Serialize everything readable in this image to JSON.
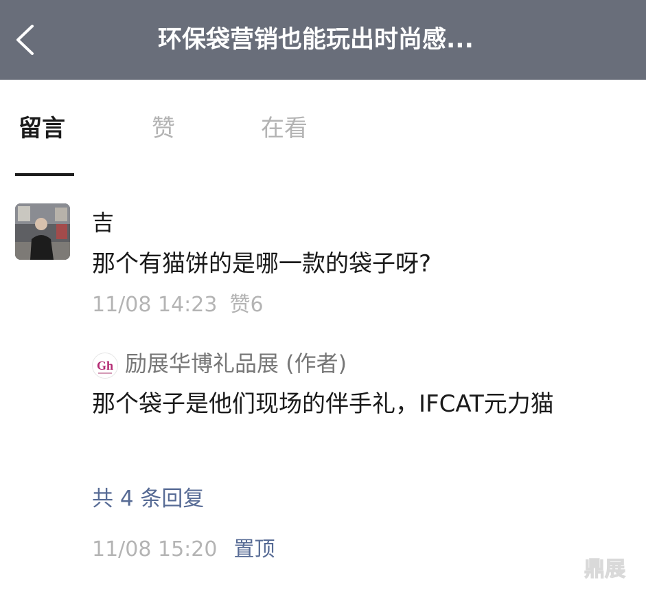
{
  "header": {
    "title": "环保袋营销也能玩出时尚感...",
    "background_color": "#696e7a",
    "back_icon": "chevron-left-icon"
  },
  "tabs": [
    {
      "label": "留言",
      "active": true
    },
    {
      "label": "赞",
      "active": false
    },
    {
      "label": "在看",
      "active": false
    }
  ],
  "comment": {
    "nickname": "吉",
    "text": "那个有猫饼的是哪一款的袋子呀?",
    "time": "11/08 14:23",
    "like_label": "赞6"
  },
  "reply": {
    "author": "励展华博礼品展 (作者)",
    "text": "那个袋子是他们现场的伴手礼，IFCAT元力猫",
    "reply_count": "共 4 条回复",
    "time": "11/08 15:20",
    "pin_label": "置顶",
    "link_color": "#576b95"
  },
  "watermark": {
    "text": "鼎展"
  }
}
